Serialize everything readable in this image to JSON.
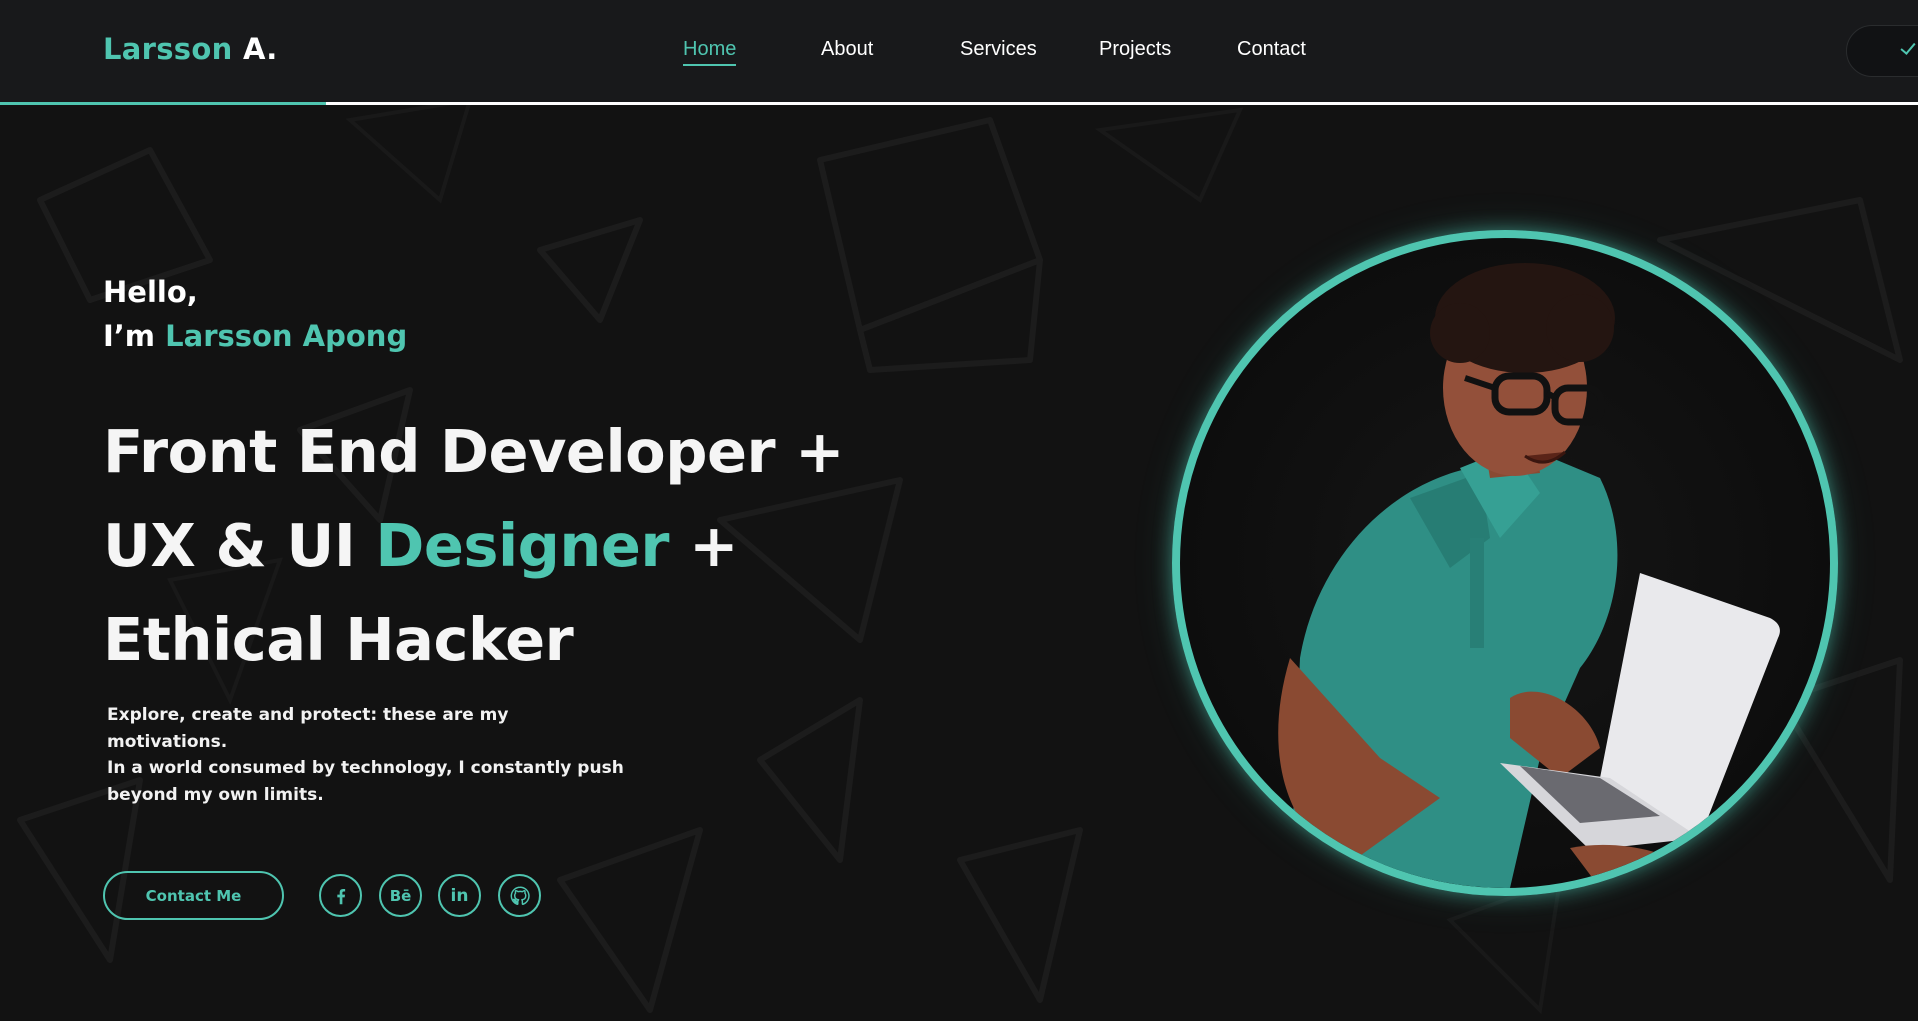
{
  "header": {
    "logo_first": "Larsson",
    "logo_last": "A.",
    "nav": [
      {
        "label": "Home",
        "active": true
      },
      {
        "label": "About",
        "active": false
      },
      {
        "label": "Services",
        "active": false
      },
      {
        "label": "Projects",
        "active": false
      },
      {
        "label": "Contact",
        "active": false
      }
    ],
    "scroll_progress": 0.17
  },
  "hero": {
    "greeting": "Hello,",
    "intro_prefix": "I’m",
    "name": "Larsson Apong",
    "headline": {
      "line1": "Front End Developer +",
      "line2_plain": "UX & UI",
      "line2_accent": "Designer",
      "line2_suffix": "+",
      "line3": "Ethical Hacker"
    },
    "bio": {
      "line1": "Explore, create and protect: these are my motivations.",
      "line2": "In a world consumed by technology, I constantly push",
      "line3": "beyond my own limits."
    },
    "cta_label": "Contact Me",
    "socials": [
      {
        "name": "facebook-icon",
        "glyph": "f"
      },
      {
        "name": "behance-icon",
        "glyph": "Bē"
      },
      {
        "name": "linkedin-icon",
        "glyph": "in"
      },
      {
        "name": "github-icon",
        "glyph": ""
      }
    ]
  },
  "colors": {
    "accent": "#4fc5b0",
    "background": "#121212",
    "header_bg": "#18191b",
    "text": "#ffffff"
  }
}
